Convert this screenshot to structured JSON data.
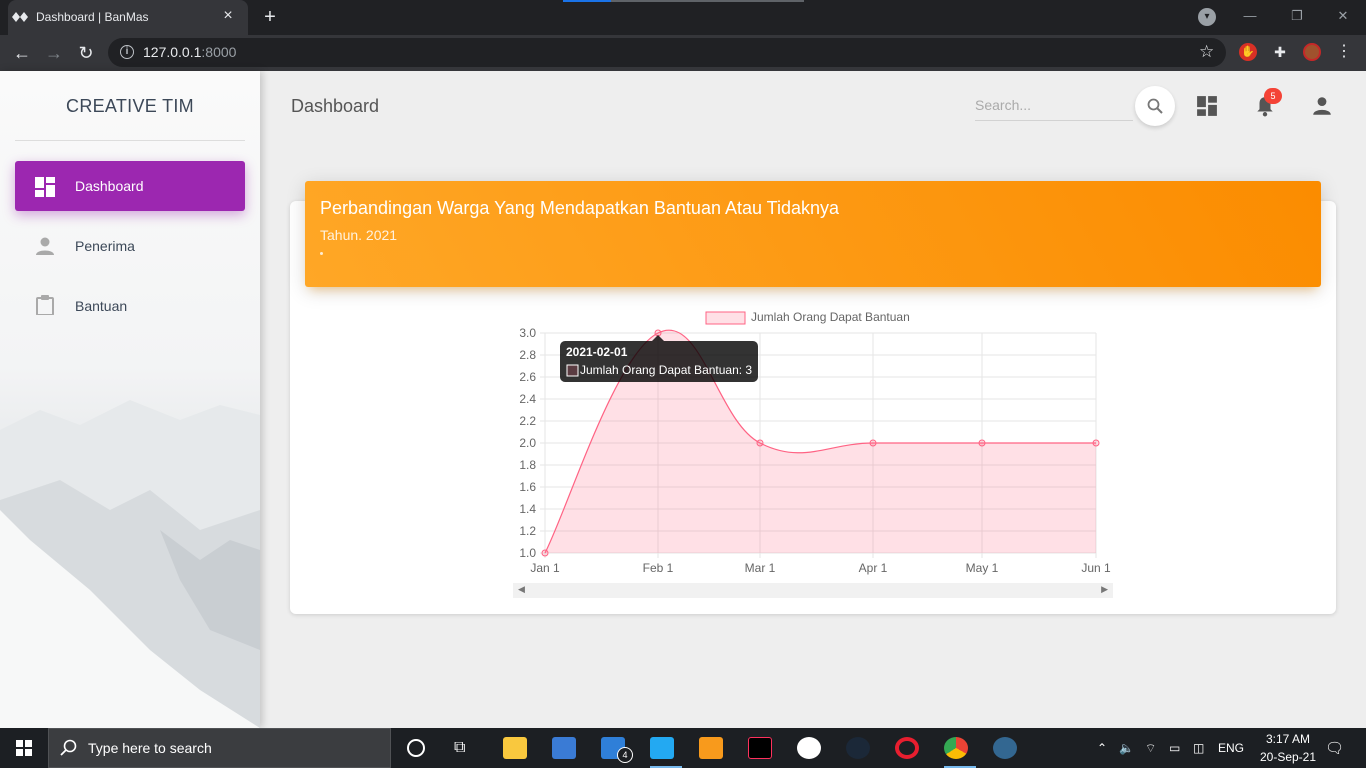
{
  "browser": {
    "tab_title": "Dashboard | BanMas",
    "tab_close": "×",
    "new_tab": "+",
    "url_host": "127.0.0.1",
    "url_port": ":8000",
    "back": "←",
    "forward": "→",
    "reload": "↻",
    "star": "☆",
    "minimize": "—",
    "restore": "❐",
    "close": "✕"
  },
  "sidebar": {
    "brand": "CREATIVE TIM",
    "items": [
      {
        "label": "Dashboard",
        "icon": "dashboard-icon",
        "active": true
      },
      {
        "label": "Penerima",
        "icon": "person-icon",
        "active": false
      },
      {
        "label": "Bantuan",
        "icon": "clipboard-icon",
        "active": false
      }
    ]
  },
  "header": {
    "title": "Dashboard",
    "search_placeholder": "Search...",
    "notification_count": "5"
  },
  "card": {
    "title": "Perbandingan Warga Yang Mendapatkan Bantuan Atau Tidaknya",
    "subtitle": "Tahun. 2021",
    "accent_color": "#fb8c00"
  },
  "chart_data": {
    "type": "area",
    "x": [
      "Jan 1",
      "Feb 1",
      "Mar 1",
      "Apr 1",
      "May 1",
      "Jun 1"
    ],
    "series": [
      {
        "name": "Jumlah Orang Dapat Bantuan",
        "values": [
          1,
          3,
          2,
          2,
          2,
          2
        ],
        "color": "#ff6384"
      }
    ],
    "yticks": [
      "3.0",
      "2.8",
      "2.6",
      "2.4",
      "2.2",
      "2.0",
      "1.8",
      "1.6",
      "1.4",
      "1.2",
      "1.0"
    ],
    "ylim": [
      1,
      3
    ],
    "grid": true,
    "legend": "top",
    "tooltip": {
      "title": "2021-02-01",
      "label": "Jumlah Orang Dapat Bantuan: 3",
      "point_index": 1
    }
  },
  "taskbar": {
    "search_text": "Type here to search",
    "language": "ENG",
    "time": "3:17 AM",
    "date": "20-Sep-21",
    "mail_badge": "4"
  }
}
